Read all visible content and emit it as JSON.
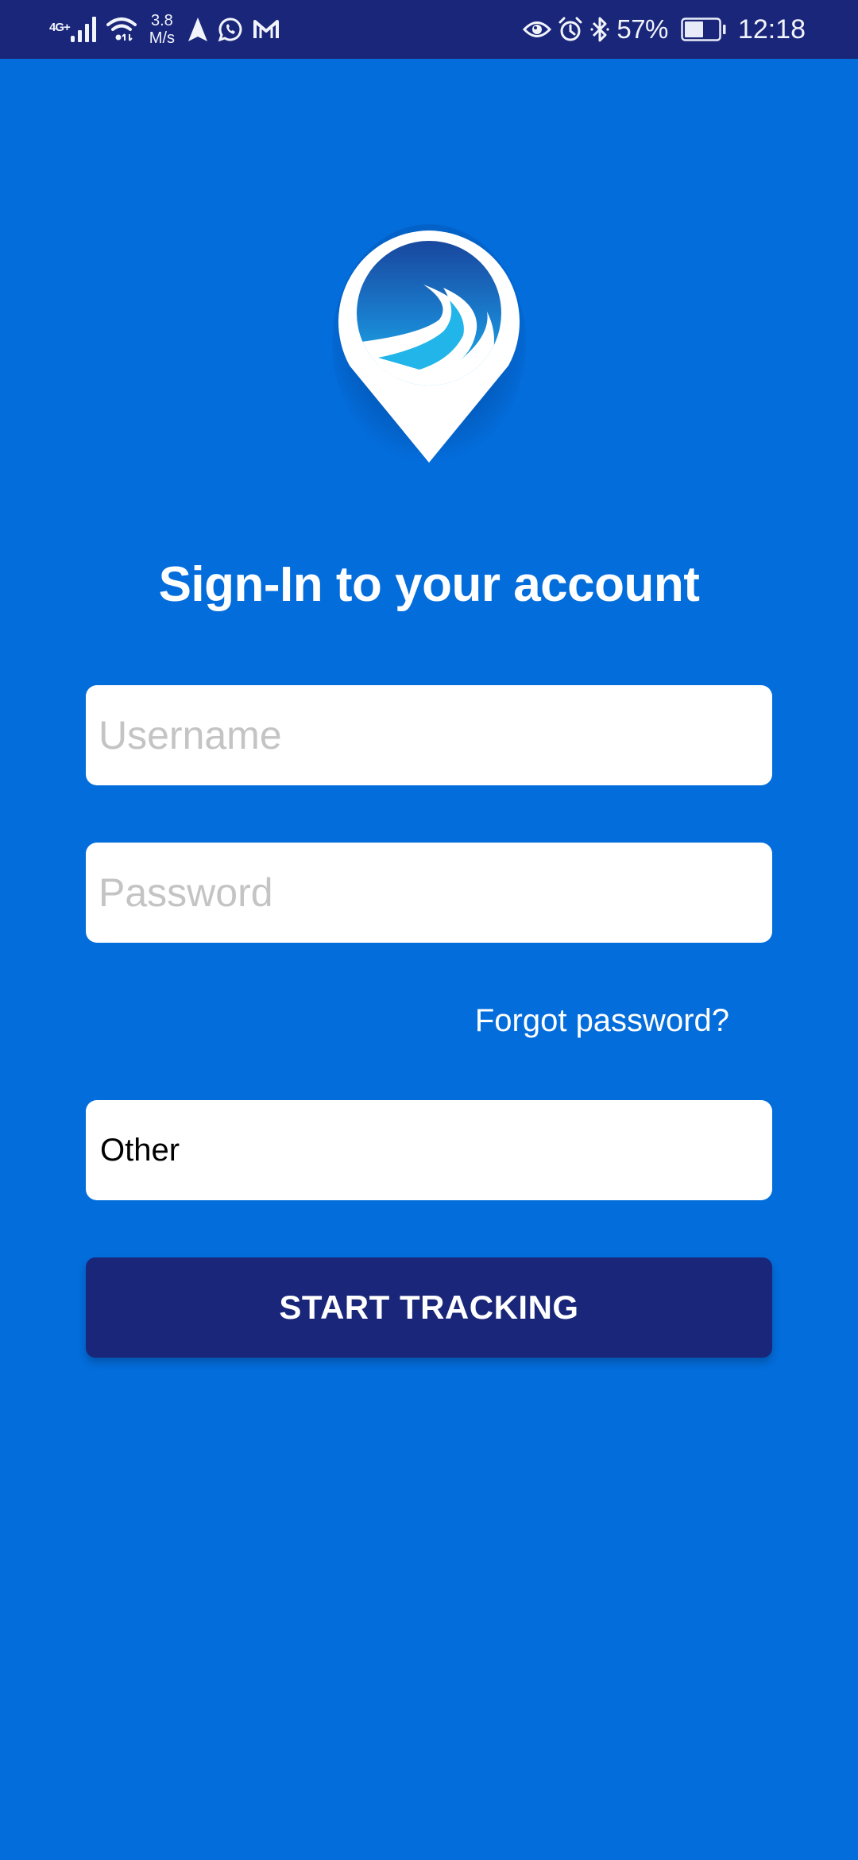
{
  "status_bar": {
    "network_type": "4G+",
    "speed_value": "3.8",
    "speed_unit": "M/s",
    "icons_left": [
      "signal-icon",
      "wifi-icon",
      "navigation-icon",
      "whatsapp-icon",
      "gmail-icon"
    ],
    "icons_right": [
      "eye-comfort-icon",
      "alarm-icon",
      "bluetooth-icon",
      "battery-icon"
    ],
    "battery_percent": "57%",
    "battery_level": 0.57,
    "time": "12:18"
  },
  "colors": {
    "background": "#036ddb",
    "status_bar": "#1a2679",
    "primary_button": "#1a2679",
    "input_bg": "#ffffff",
    "placeholder": "#c4c4c4"
  },
  "logo": {
    "icon": "location-pin-road-logo"
  },
  "login": {
    "title": "Sign-In to your account",
    "username": {
      "value": "",
      "placeholder": "Username"
    },
    "password": {
      "value": "",
      "placeholder": "Password"
    },
    "forgot_password_label": "Forgot password?",
    "selector": {
      "selected": "Other"
    },
    "submit_label": "START TRACKING"
  }
}
